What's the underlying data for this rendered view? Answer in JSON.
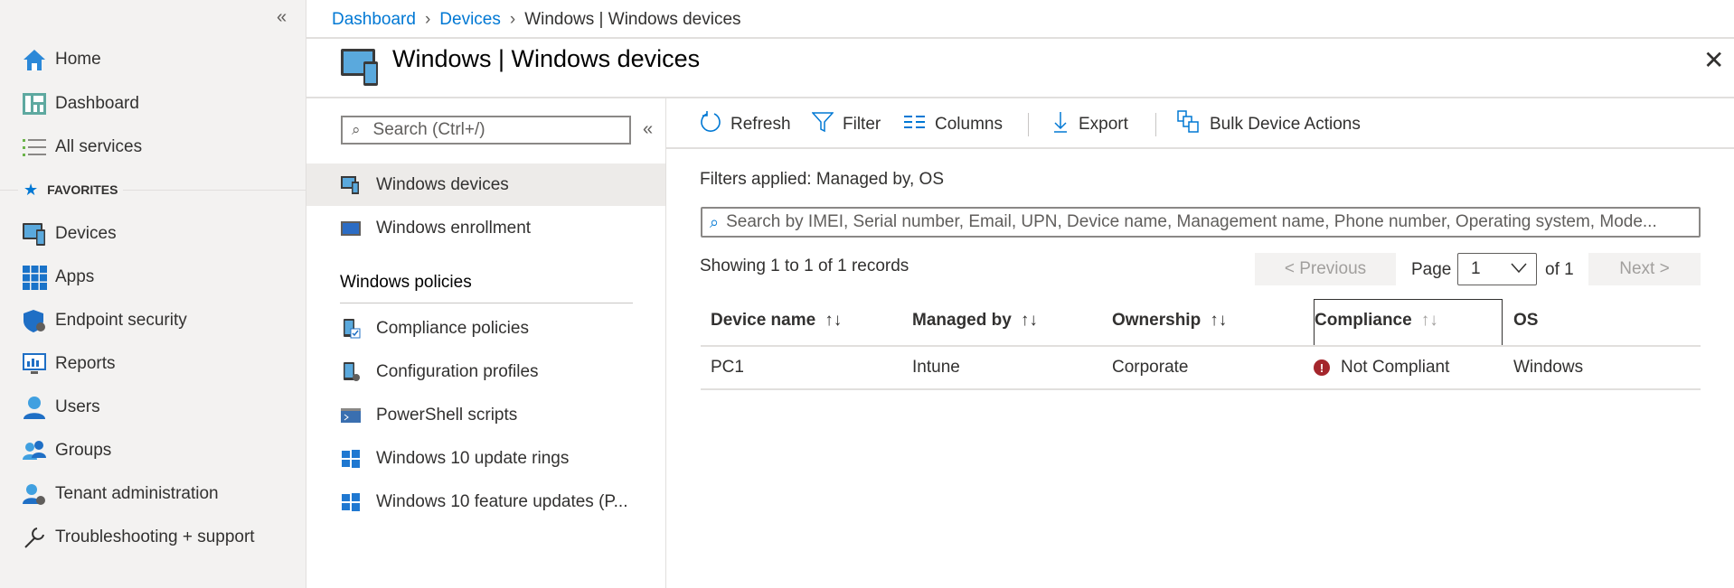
{
  "sidebar": {
    "collapse_icon": "double-chevron-left",
    "items": [
      {
        "label": "Home",
        "icon": "home-icon"
      },
      {
        "label": "Dashboard",
        "icon": "dashboard-icon"
      },
      {
        "label": "All services",
        "icon": "list-icon"
      }
    ],
    "favorites_label": "FAVORITES",
    "favorites": [
      {
        "label": "Devices",
        "icon": "devices-icon"
      },
      {
        "label": "Apps",
        "icon": "apps-icon"
      },
      {
        "label": "Endpoint security",
        "icon": "shield-icon"
      },
      {
        "label": "Reports",
        "icon": "reports-icon"
      },
      {
        "label": "Users",
        "icon": "user-icon"
      },
      {
        "label": "Groups",
        "icon": "groups-icon"
      },
      {
        "label": "Tenant administration",
        "icon": "tenant-icon"
      },
      {
        "label": "Troubleshooting + support",
        "icon": "wrench-icon"
      }
    ]
  },
  "breadcrumb": [
    "Dashboard",
    "Devices",
    "Windows | Windows devices"
  ],
  "header": {
    "title": "Windows | Windows devices"
  },
  "subnav": {
    "search_placeholder": "Search (Ctrl+/)",
    "items": [
      {
        "label": "Windows devices",
        "selected": true
      },
      {
        "label": "Windows enrollment"
      }
    ],
    "section": "Windows policies",
    "policies": [
      "Compliance policies",
      "Configuration profiles",
      "PowerShell scripts",
      "Windows 10 update rings",
      "Windows 10 feature updates (P..."
    ]
  },
  "toolbar": {
    "refresh": "Refresh",
    "filter": "Filter",
    "columns": "Columns",
    "export": "Export",
    "bulk": "Bulk Device Actions"
  },
  "filters_applied": "Filters applied: Managed by, OS",
  "search_placeholder": "Search by IMEI, Serial number, Email, UPN, Device name, Management name, Phone number, Operating system, Mode...",
  "paging": {
    "showing": "Showing 1 to 1 of 1 records",
    "previous": "< Previous",
    "page_label": "Page",
    "page": "1",
    "of": "of 1",
    "next": "Next >"
  },
  "table": {
    "columns": [
      "Device name",
      "Managed by",
      "Ownership",
      "Compliance",
      "OS"
    ],
    "sort_glyph": "↑↓",
    "rows": [
      {
        "device": "PC1",
        "managed": "Intune",
        "ownership": "Corporate",
        "compliance": "Not Compliant",
        "os": "Windows"
      }
    ]
  },
  "colors": {
    "accent": "#0078d4",
    "error": "#a4262c"
  }
}
